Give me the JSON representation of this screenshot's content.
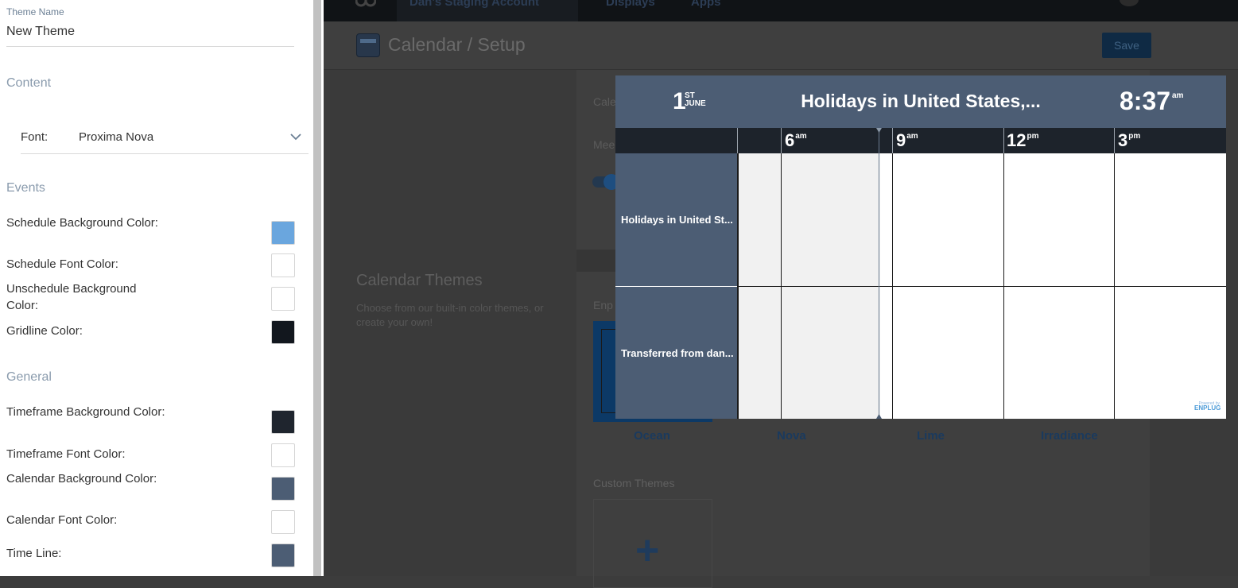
{
  "panel": {
    "theme_name_label": "Theme Name",
    "theme_name_value": "New Theme",
    "sections": {
      "content": "Content",
      "events": "Events",
      "general": "General"
    },
    "font_label": "Font:",
    "font_value": "Proxima Nova",
    "event_rows": [
      {
        "label": "Schedule Background Color:",
        "color": "#6aa6de"
      },
      {
        "label": "Schedule Font Color:",
        "color": "#ffffff"
      },
      {
        "label": "Unschedule Background Color:",
        "color": "#ffffff"
      },
      {
        "label": "Gridline Color:",
        "color": "#12171e"
      }
    ],
    "general_rows": [
      {
        "label": "Timeframe Background Color:",
        "color": "#1f252e"
      },
      {
        "label": "Timeframe Font Color:",
        "color": "#ffffff"
      },
      {
        "label": "Calendar Background Color:",
        "color": "#4c5d74"
      },
      {
        "label": "Calendar Font Color:",
        "color": "#ffffff"
      },
      {
        "label": "Time Line:",
        "color": "#4c5d74"
      }
    ]
  },
  "background": {
    "topbar": {
      "account": "Dan's Staging Account",
      "displays": "Displays",
      "apps": "Apps"
    },
    "page_title": "Calendar / Setup",
    "save_label": "Save",
    "calendar_themes_title": "Calendar Themes",
    "calendar_themes_desc": "Choose from our built-in color themes, or create your own!",
    "cale_fragment": "Cale",
    "mee_fragment": "Mee",
    "enp_fragment": "Enp",
    "themes": [
      "Ocean",
      "Nova",
      "Lime",
      "Irradiance"
    ],
    "custom_themes_label": "Custom Themes",
    "add_symbol": "+"
  },
  "preview": {
    "day_number": "1",
    "day_suffix": "ST",
    "month": "JUNE",
    "title": "Holidays in United States,...",
    "time": "8:37",
    "time_ampm": "am",
    "hours": [
      {
        "hour": "6",
        "ampm": "am"
      },
      {
        "hour": "9",
        "ampm": "am"
      },
      {
        "hour": "12",
        "ampm": "pm"
      },
      {
        "hour": "3",
        "ampm": "pm"
      }
    ],
    "rows": [
      "Holidays in United St...",
      "Transferred from dan..."
    ],
    "powered_by": "Powered by",
    "brand": "ENPLUG"
  }
}
